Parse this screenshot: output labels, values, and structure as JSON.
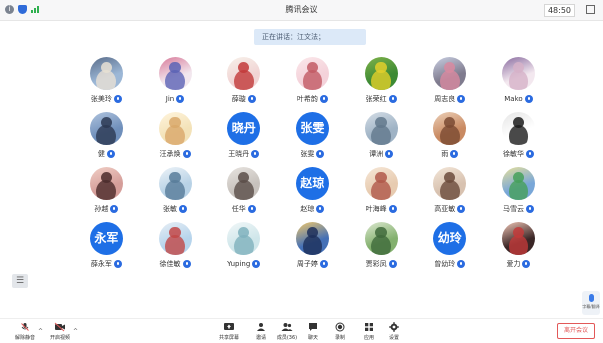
{
  "window": {
    "title": "腾讯会议",
    "timer": "48:50"
  },
  "speaking": {
    "label": "正在讲话：江文法；"
  },
  "participants": [
    {
      "name": "张美玲",
      "avatar": "photo",
      "colors": [
        "#9cb7d6",
        "#e8e0d4",
        "#5a6d8a"
      ]
    },
    {
      "name": "Jin",
      "avatar": "photo",
      "colors": [
        "#f2e7ee",
        "#5b63b5",
        "#d87a9a"
      ]
    },
    {
      "name": "薛璇",
      "avatar": "photo",
      "colors": [
        "#f1d4d4",
        "#c23a3a",
        "#f7f1ea"
      ]
    },
    {
      "name": "叶希韵",
      "avatar": "photo",
      "colors": [
        "#f4d2da",
        "#c25a64",
        "#fbe7ea"
      ]
    },
    {
      "name": "张荣红",
      "avatar": "photo",
      "colors": [
        "#3d8a34",
        "#e2cf2b",
        "#7fb24a"
      ]
    },
    {
      "name": "周志良",
      "avatar": "photo",
      "colors": [
        "#7f7b8e",
        "#d88aa0",
        "#c9cfe2"
      ]
    },
    {
      "name": "Mako",
      "avatar": "photo",
      "colors": [
        "#f3e8ef",
        "#d6b2c8",
        "#8a6ca0"
      ]
    },
    {
      "name": "健",
      "avatar": "photo",
      "colors": [
        "#6f8fbb",
        "#2c3852",
        "#b0c4de"
      ]
    },
    {
      "name": "汪承焕",
      "avatar": "photo",
      "colors": [
        "#f3e2b8",
        "#d9a86a",
        "#fff4dc"
      ]
    },
    {
      "name": "王晓丹",
      "avatar": "text",
      "initials": "晓丹"
    },
    {
      "name": "张雯",
      "avatar": "text",
      "initials": "张雯"
    },
    {
      "name": "谭洲",
      "avatar": "photo",
      "colors": [
        "#9fb3c5",
        "#61788c",
        "#d4dde6"
      ]
    },
    {
      "name": "雨",
      "avatar": "photo",
      "colors": [
        "#c98a62",
        "#7a4a32",
        "#ecd0b8"
      ]
    },
    {
      "name": "徐敏华",
      "avatar": "photo",
      "colors": [
        "#ffffff",
        "#1b1b1b",
        "#e5e5e5"
      ]
    },
    {
      "name": "孙越",
      "avatar": "photo",
      "colors": [
        "#d59e9a",
        "#4b2b2b",
        "#f1cfc6"
      ]
    },
    {
      "name": "张敏",
      "avatar": "photo",
      "colors": [
        "#b8d2e6",
        "#587c9a",
        "#edf3f8"
      ]
    },
    {
      "name": "任华",
      "avatar": "photo",
      "colors": [
        "#c7c2bd",
        "#5a4e49",
        "#e8e4e0"
      ]
    },
    {
      "name": "赵琼",
      "avatar": "text",
      "initials": "赵琼"
    },
    {
      "name": "叶海峰",
      "avatar": "photo",
      "colors": [
        "#e7cbb0",
        "#b0584a",
        "#f6e7d7"
      ]
    },
    {
      "name": "高亚敏",
      "avatar": "photo",
      "colors": [
        "#d8c2b0",
        "#6c4b3c",
        "#f3e6d8"
      ]
    },
    {
      "name": "马雪云",
      "avatar": "photo",
      "colors": [
        "#79a7d8",
        "#46a05a",
        "#e7e09c"
      ]
    },
    {
      "name": "薛永军",
      "avatar": "text",
      "initials": "永军"
    },
    {
      "name": "徐佳敏",
      "avatar": "photo",
      "colors": [
        "#b6d4ec",
        "#c24646",
        "#e7eef5"
      ]
    },
    {
      "name": "Yuping",
      "avatar": "photo",
      "colors": [
        "#cfe6ea",
        "#7fb2bd",
        "#f1f7f8"
      ]
    },
    {
      "name": "周子婷",
      "avatar": "photo",
      "colors": [
        "#4470b6",
        "#1d2f5a",
        "#f0c86c"
      ]
    },
    {
      "name": "贾彩凤",
      "avatar": "photo",
      "colors": [
        "#83b06e",
        "#3f6a3b",
        "#dce8cf"
      ]
    },
    {
      "name": "曾幼玲",
      "avatar": "text",
      "initials": "幼玲"
    },
    {
      "name": "爱力",
      "avatar": "photo",
      "colors": [
        "#3a2626",
        "#c23a3a",
        "#f1c6b6"
      ]
    }
  ],
  "side": {
    "list_icon": "☰"
  },
  "translate": {
    "label": "字幕/翻译"
  },
  "toolbar": {
    "mute": "解除静音",
    "video": "开启视频",
    "share": "共享屏幕",
    "invite": "邀请",
    "members": "成员(36)",
    "chat": "聊天",
    "record": "录制",
    "apps": "应用",
    "settings": "设置",
    "leave": "离开会议"
  },
  "colors": {
    "accent": "#1e6fe6",
    "leave": "#e25858",
    "speaking_bg": "#dce9f8"
  }
}
